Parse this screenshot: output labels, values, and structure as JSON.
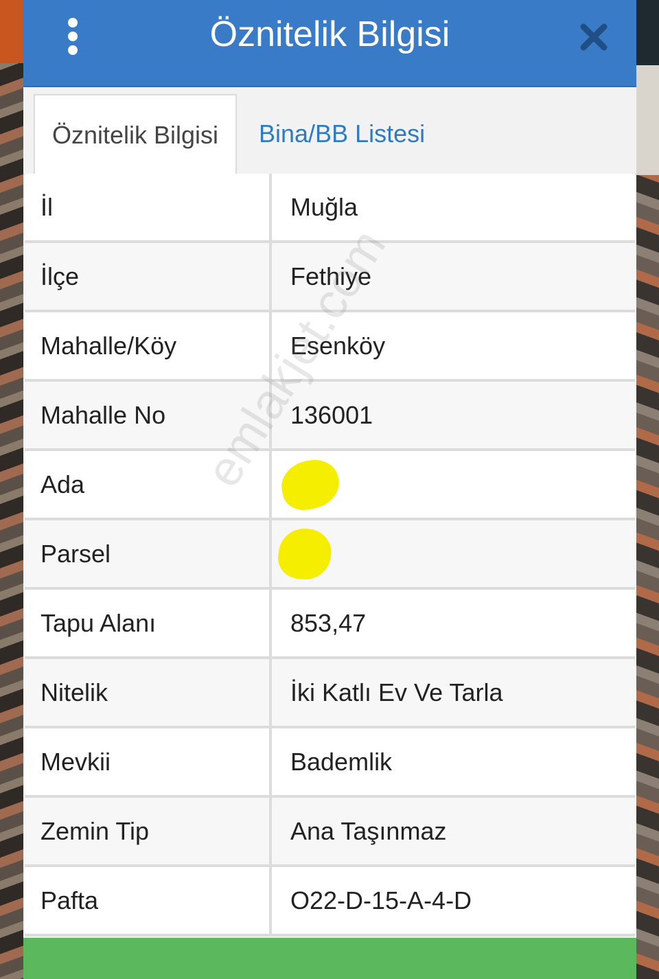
{
  "header": {
    "title": "Öznitelik Bilgisi",
    "menu_icon": "kebab-menu-icon",
    "close_icon": "close-icon",
    "accent_color": "#3a7bc8"
  },
  "tabs": [
    {
      "label": "Öznitelik Bilgisi",
      "active": true
    },
    {
      "label": "Bina/BB Listesi",
      "active": false
    }
  ],
  "attributes": [
    {
      "label": "İl",
      "value": "Muğla"
    },
    {
      "label": "İlçe",
      "value": "Fethiye"
    },
    {
      "label": "Mahalle/Köy",
      "value": "Esenköy"
    },
    {
      "label": "Mahalle No",
      "value": "136001"
    },
    {
      "label": "Ada",
      "value": ""
    },
    {
      "label": "Parsel",
      "value": ""
    },
    {
      "label": "Tapu Alanı",
      "value": "853,47"
    },
    {
      "label": "Nitelik",
      "value": "İki Katlı Ev Ve Tarla"
    },
    {
      "label": "Mevkii",
      "value": "Bademlik"
    },
    {
      "label": "Zemin Tip",
      "value": "Ana Taşınmaz"
    },
    {
      "label": "Pafta",
      "value": "O22-D-15-A-4-D"
    }
  ],
  "watermark": "emlakjet.com",
  "footer_button_color": "#5cb85c"
}
